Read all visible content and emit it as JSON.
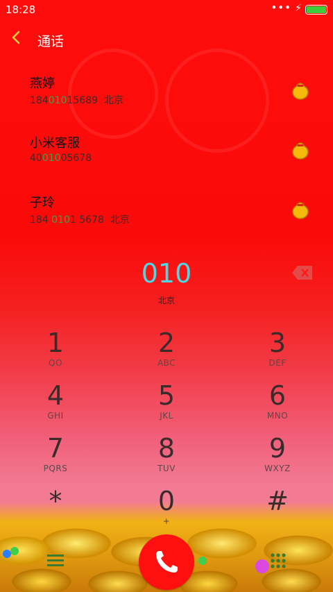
{
  "status_bar": {
    "time": "18:28",
    "dots": "•••",
    "charging": "⚡"
  },
  "header": {
    "back_icon": "chevron-left-icon",
    "title": "通话"
  },
  "contacts": [
    {
      "name": "燕婷",
      "number_pre": "184",
      "number_hl": "010",
      "number_post": "15689",
      "location": "北京"
    },
    {
      "name": "小米客服",
      "number_pre": "40",
      "number_hl": "010",
      "number_post": "05678",
      "location": ""
    },
    {
      "name": "子玲",
      "number_pre": "184 ",
      "number_hl": "010",
      "number_post": "1 5678",
      "location": "北京"
    }
  ],
  "dial": {
    "number": "010",
    "location": "北京"
  },
  "keys": [
    {
      "digit": "1",
      "letters": "QO"
    },
    {
      "digit": "2",
      "letters": "ABC"
    },
    {
      "digit": "3",
      "letters": "DEF"
    },
    {
      "digit": "4",
      "letters": "GHI"
    },
    {
      "digit": "5",
      "letters": "JKL"
    },
    {
      "digit": "6",
      "letters": "MNO"
    },
    {
      "digit": "7",
      "letters": "PQRS"
    },
    {
      "digit": "8",
      "letters": "TUV"
    },
    {
      "digit": "9",
      "letters": "WXYZ"
    },
    {
      "digit": "*",
      "letters": ""
    },
    {
      "digit": "0",
      "letters": "+"
    },
    {
      "digit": "#",
      "letters": ""
    }
  ],
  "colors": {
    "accent": "#4fd6e4",
    "highlight": "#3ba14a",
    "call": "#ff1010",
    "back": "#ffd236"
  }
}
